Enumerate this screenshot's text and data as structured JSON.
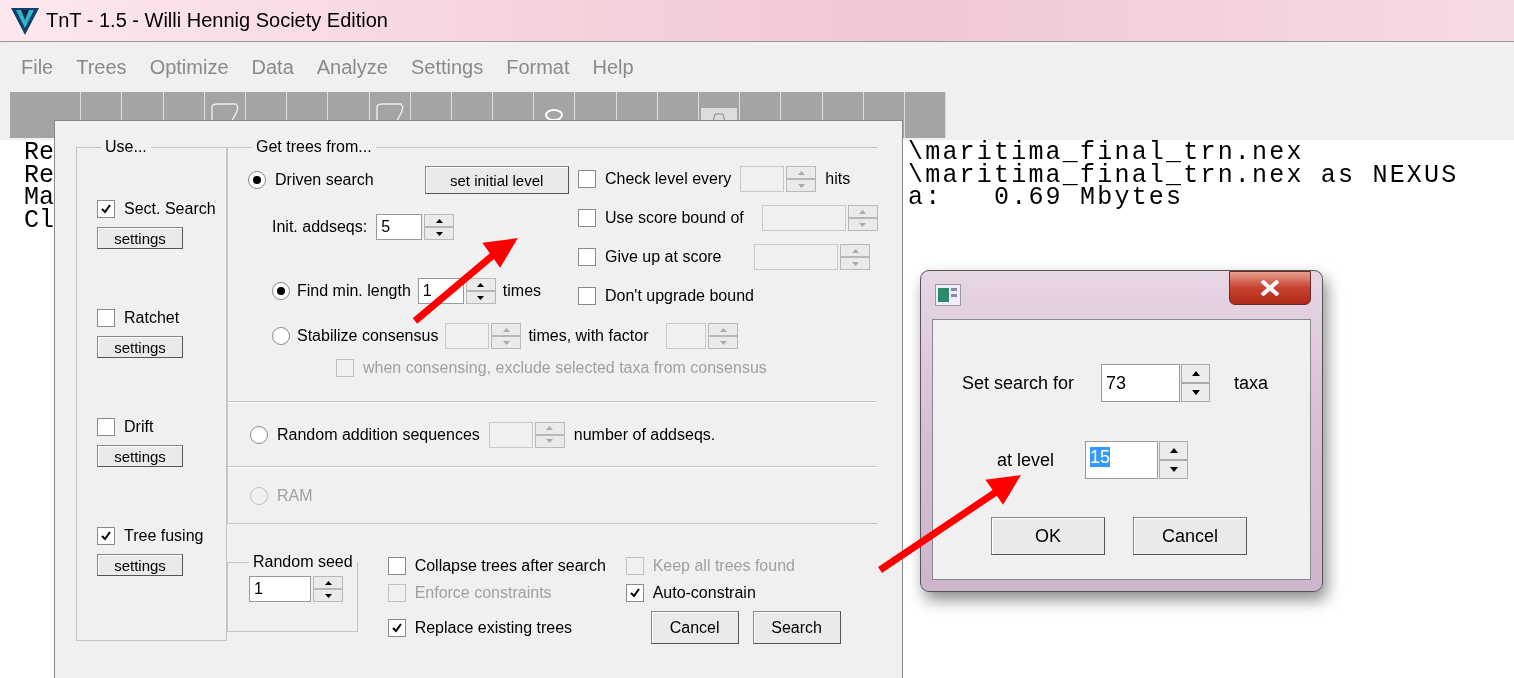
{
  "app": {
    "title": "TnT - 1.5 - Willi Hennig Society Edition",
    "menu": [
      "File",
      "Trees",
      "Optimize",
      "Data",
      "Analyze",
      "Settings",
      "Format",
      "Help"
    ],
    "console_left": [
      "Re",
      "Re",
      "Ma",
      "Cl"
    ],
    "console_right": [
      "\\maritima_final_trn.nex",
      "\\maritima_final_trn.nex as NEXUS",
      "a:   0.69 Mbytes"
    ]
  },
  "search_dialog": {
    "use_group": {
      "title": "Use...",
      "items": [
        {
          "label": "Sect. Search",
          "checked": true,
          "button": "settings"
        },
        {
          "label": "Ratchet",
          "checked": false,
          "button": "settings"
        },
        {
          "label": "Drift",
          "checked": false,
          "button": "settings"
        },
        {
          "label": "Tree fusing",
          "checked": true,
          "button": "settings"
        }
      ]
    },
    "get_trees_group": {
      "title": "Get trees from...",
      "driven_search": {
        "label": "Driven search",
        "selected": true,
        "button": "set initial level"
      },
      "init_addseqs": {
        "label": "Init. addseqs:",
        "value": "5"
      },
      "find_min_length": {
        "label": "Find min. length",
        "selected": true,
        "value": "1",
        "suffix": "times"
      },
      "stabilize_consensus": {
        "label": "Stabilize consensus",
        "selected": false,
        "suffix": "times, with factor"
      },
      "exclude_selected": {
        "label": "when consensing, exclude selected taxa from consensus",
        "checked": false,
        "disabled": true
      },
      "options": [
        {
          "kind": "spin_suffix",
          "label": "Check level every",
          "checked": false,
          "suffix": "hits"
        },
        {
          "kind": "spin",
          "label": "Use score bound of",
          "checked": false
        },
        {
          "kind": "spin",
          "label": "Give up at score",
          "checked": false
        },
        {
          "kind": "plain",
          "label": "Don't upgrade bound",
          "checked": false
        }
      ]
    },
    "random_addition": {
      "label": "Random addition sequences",
      "selected": false,
      "suffix": "number of addseqs."
    },
    "ram": {
      "label": "RAM",
      "selected": false,
      "disabled": true
    },
    "random_seed": {
      "title": "Random seed",
      "value": "1"
    },
    "checks": [
      {
        "label": "Collapse trees after search",
        "checked": false,
        "disabled": false
      },
      {
        "label": "Keep all trees found",
        "checked": false,
        "disabled": true
      },
      {
        "label": "Enforce constraints",
        "checked": false,
        "disabled": true
      },
      {
        "label": "Auto-constrain",
        "checked": true,
        "disabled": false
      },
      {
        "label": "Replace existing trees",
        "checked": true,
        "disabled": false
      }
    ],
    "buttons": [
      "Cancel",
      "Search"
    ]
  },
  "level_dialog": {
    "taxa_label": "Set search for",
    "taxa_value": "73",
    "taxa_unit": "taxa",
    "level_label": "at level",
    "level_value": "15",
    "level_value_selected": true,
    "buttons": [
      "OK",
      "Cancel"
    ]
  }
}
